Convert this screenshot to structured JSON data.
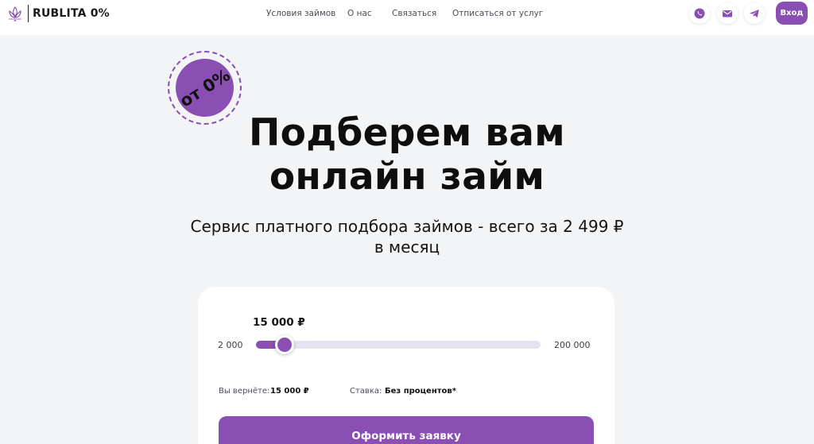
{
  "brand": {
    "name": "RUBLITA 0%",
    "logo_icon": "lotus-logo-icon",
    "accent_color": "#8a4fb2"
  },
  "nav": {
    "items": [
      {
        "label": "Условия займов"
      },
      {
        "label": "О нас"
      },
      {
        "label": "Связаться"
      },
      {
        "label": "Отписаться от услуг"
      }
    ]
  },
  "header_actions": {
    "icons": [
      "phone-icon",
      "mail-icon",
      "telegram-icon"
    ],
    "login_label": "Вход"
  },
  "badge": {
    "text": "от 0%"
  },
  "hero": {
    "title_line1": "Подберем вам",
    "title_line2": "онлайн займ",
    "subtitle_line1": "Сервис платного подбора займов - всего за 2 499 ₽",
    "subtitle_line2": "в месяц"
  },
  "calculator": {
    "amount_display": "15 000 ₽",
    "min_label": "2 000",
    "max_label": "200 000",
    "slider_min": 2000,
    "slider_max": 200000,
    "slider_value": 15000,
    "return_label": "Вы вернёте:",
    "return_value": "15 000 ₽",
    "rate_label": "Ставка:",
    "rate_value": "Без процентов*",
    "submit_label": "Оформить заявку"
  }
}
